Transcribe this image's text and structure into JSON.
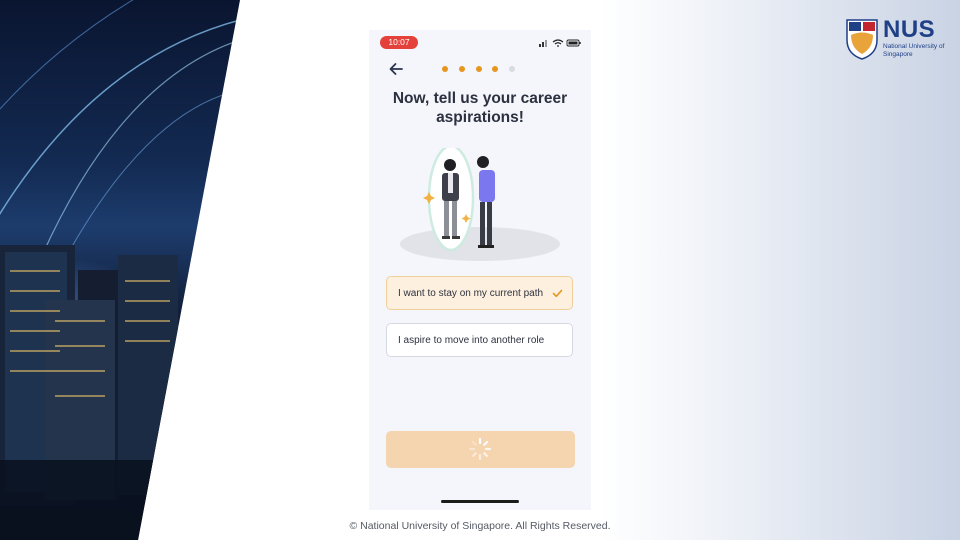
{
  "status_bar": {
    "time": "10:07"
  },
  "onboarding": {
    "progress": {
      "total_steps": 5,
      "completed_steps": 4
    },
    "title": "Now, tell us your career aspirations!",
    "options": [
      {
        "label": "I want to stay on my current path",
        "selected": true
      },
      {
        "label": "I aspire to move into another role",
        "selected": false
      }
    ],
    "continue_state": "loading"
  },
  "branding": {
    "wordmark": "NUS",
    "subtitle": "National University of Singapore"
  },
  "footer": {
    "copyright": "© National University of Singapore. All Rights Reserved."
  },
  "colors": {
    "accent": "#e6961f",
    "status_time_bg": "#e3413a",
    "selected_option_bg": "#fdf0de",
    "button_disabled_bg": "#f5d4b0",
    "brand_blue": "#1f3f87"
  },
  "icons": [
    "back-arrow-icon",
    "check-icon",
    "spinner-icon",
    "signal-icon",
    "wifi-icon",
    "battery-icon"
  ]
}
